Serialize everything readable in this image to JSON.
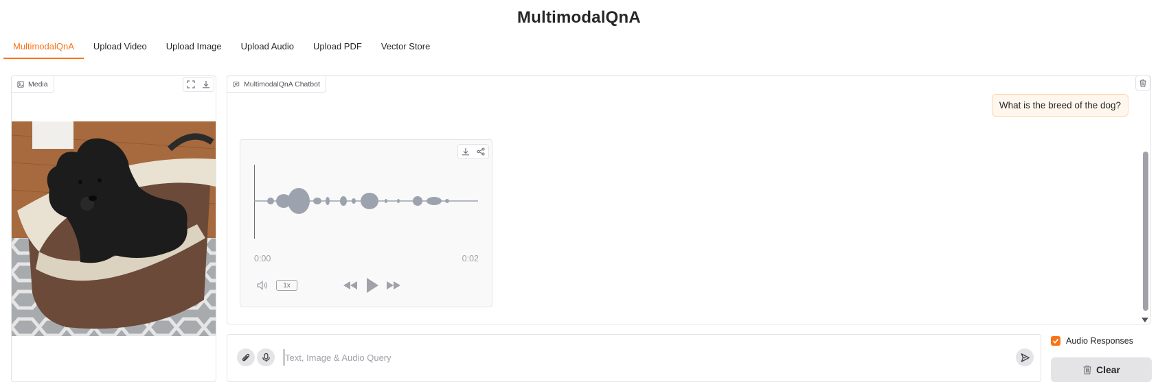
{
  "app": {
    "title": "MultimodalQnA"
  },
  "tabs": [
    {
      "label": "MultimodalQnA",
      "active": true
    },
    {
      "label": "Upload Video",
      "active": false
    },
    {
      "label": "Upload Image",
      "active": false
    },
    {
      "label": "Upload Audio",
      "active": false
    },
    {
      "label": "Upload PDF",
      "active": false
    },
    {
      "label": "Vector Store",
      "active": false
    }
  ],
  "media": {
    "label": "Media",
    "icons": [
      "image-icon",
      "fullscreen-icon",
      "download-icon"
    ]
  },
  "chatbot": {
    "label": "MultimodalQnA Chatbot",
    "user_message": "What is the breed of the dog?",
    "audio": {
      "current_time": "0:00",
      "duration": "0:02",
      "speed": "1x",
      "progress": 0
    }
  },
  "query": {
    "placeholder": "Text, Image & Audio Query",
    "value": ""
  },
  "options": {
    "audio_responses_label": "Audio Responses",
    "audio_responses_checked": true
  },
  "actions": {
    "clear_label": "Clear"
  },
  "colors": {
    "accent": "#f97316",
    "user_bubble_bg": "#fff7ed",
    "user_bubble_border": "#fed7aa",
    "waveform": "#9ca3af"
  }
}
